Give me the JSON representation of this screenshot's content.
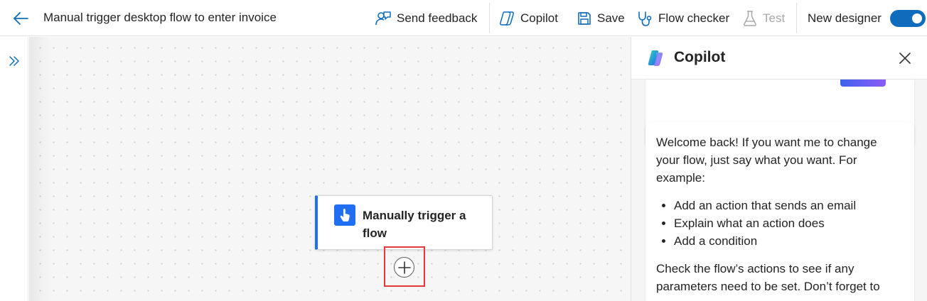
{
  "header": {
    "flow_title": "Manual trigger desktop flow to enter invoice",
    "send_feedback": "Send feedback",
    "copilot": "Copilot",
    "save": "Save",
    "flow_checker": "Flow checker",
    "test": "Test",
    "new_designer": "New designer",
    "new_designer_enabled": true
  },
  "canvas": {
    "trigger_card": {
      "label": "Manually trigger a flow",
      "icon": "touch-hand-icon"
    },
    "add_step_icon": "plus-circle-icon"
  },
  "copilot_panel": {
    "title": "Copilot",
    "message": {
      "intro": "Welcome back! If you want me to change your flow, just say what you want. For example:",
      "examples": [
        "Add an action that sends an email",
        "Explain what an action does",
        "Add a condition"
      ],
      "outro": "Check the flow’s actions to see if any parameters need to be set. Don’t forget to"
    }
  },
  "colors": {
    "accent": "#0f6cbd",
    "trigger_accent": "#1f6ff0",
    "highlight": "#e03a3a"
  }
}
